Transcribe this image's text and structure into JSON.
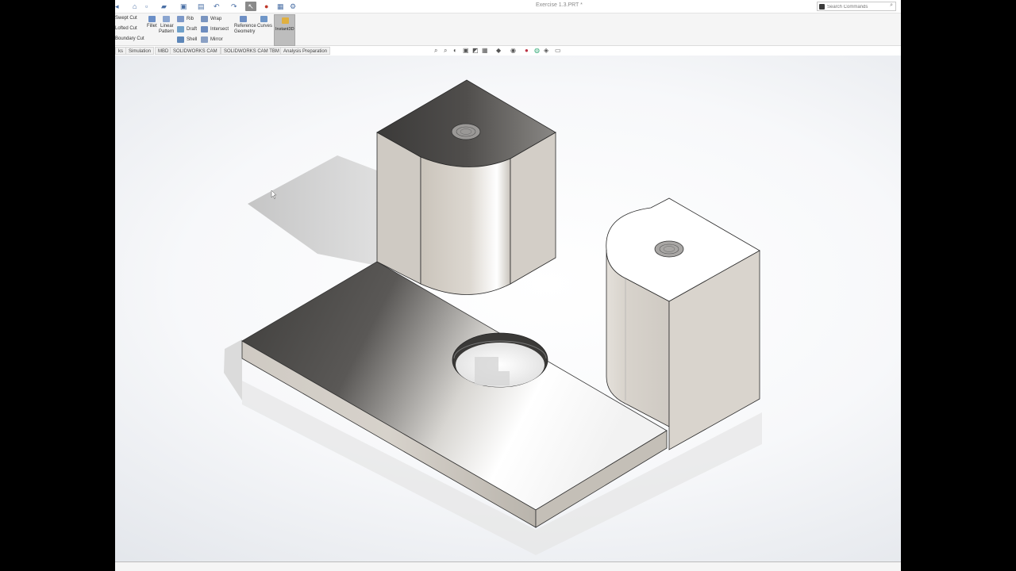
{
  "window": {
    "document_title": "Exercise 1.3.PRT *"
  },
  "search": {
    "placeholder": "Search Commands"
  },
  "ribbon": {
    "swept_cut": "Swept Cut",
    "lofted_cut": "Lofted Cut",
    "boundary_cut": "Boundary Cut",
    "fillet": "Fillet",
    "linear_pattern_line1": "Linear",
    "linear_pattern_line2": "Pattern",
    "rib": "Rib",
    "draft": "Draft",
    "shell": "Shell",
    "wrap": "Wrap",
    "intersect": "Intersect",
    "mirror": "Mirror",
    "reference_geometry_line1": "Reference",
    "reference_geometry_line2": "Geometry",
    "curves": "Curves",
    "instant3d": "Instant3D"
  },
  "tabs": [
    {
      "label": "ks"
    },
    {
      "label": "Simulation"
    },
    {
      "label": "MBD"
    },
    {
      "label": "SOLIDWORKS CAM"
    },
    {
      "label": "SOLIDWORKS CAM TBM"
    },
    {
      "label": "Analysis Preparation"
    }
  ],
  "icons": {
    "home": "home-icon",
    "new": "new-document-icon",
    "open": "open-folder-icon",
    "save": "save-icon",
    "print": "print-icon",
    "undo": "undo-icon",
    "redo": "redo-icon",
    "select": "select-arrow-icon",
    "rebuild": "rebuild-traffic-light-icon",
    "file_properties": "file-properties-icon",
    "options": "gear-icon",
    "search": "search-icon"
  },
  "colors": {
    "model_light": "#e8e4de",
    "model_mid": "#b8b2aa",
    "model_dark": "#4a4846",
    "viewport_bg": "#f4f5f7"
  }
}
